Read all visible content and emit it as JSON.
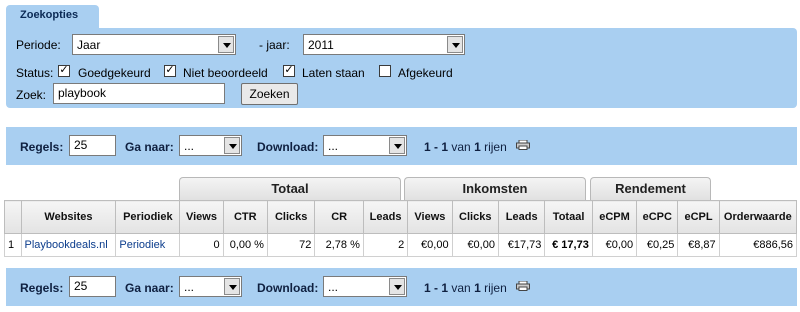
{
  "search_panel": {
    "tab_label": "Zoekopties",
    "period_label": "Periode:",
    "period_value": "Jaar",
    "year_label": "- jaar:",
    "year_value": "2011",
    "status_label": "Status:",
    "statuses": [
      {
        "label": "Goedgekeurd",
        "checked": true
      },
      {
        "label": "Niet beoordeeld",
        "checked": true
      },
      {
        "label": "Laten staan",
        "checked": true
      },
      {
        "label": "Afgekeurd",
        "checked": false
      }
    ],
    "search_label": "Zoek:",
    "search_value": "playbook",
    "search_button": "Zoeken"
  },
  "pager": {
    "rows_label": "Regels:",
    "rows_value": "25",
    "goto_label": "Ga naar:",
    "goto_value": "...",
    "download_label": "Download:",
    "download_value": "...",
    "range": "1 - 1",
    "of_text": "van",
    "total": "1",
    "rows_text": "rijen"
  },
  "groups": {
    "totaal": "Totaal",
    "inkomsten": "Inkomsten",
    "rendement": "Rendement"
  },
  "columns": [
    "",
    "Websites",
    "Periodiek",
    "Views",
    "CTR",
    "Clicks",
    "CR",
    "Leads",
    "Views",
    "Clicks",
    "Leads",
    "Totaal",
    "eCPM",
    "eCPC",
    "eCPL",
    "Orderwaarde"
  ],
  "rows": [
    {
      "index": "1",
      "website": "Playbookdeals.nl",
      "periodiek": "Periodiek",
      "views": "0",
      "ctr": "0,00 %",
      "clicks": "72",
      "cr": "2,78 %",
      "leads": "2",
      "ink_views": "€0,00",
      "ink_clicks": "€0,00",
      "ink_leads": "€17,73",
      "ink_totaal": "€ 17,73",
      "ecpm": "€0,00",
      "ecpc": "€0,25",
      "ecpl": "€8,87",
      "orderwaarde": "€886,56"
    }
  ],
  "icons": {
    "printer": "printer-icon",
    "dropdown": "chevron-down-icon"
  },
  "colors": {
    "panel": "#a9cff1",
    "link": "#0b3c8c"
  }
}
